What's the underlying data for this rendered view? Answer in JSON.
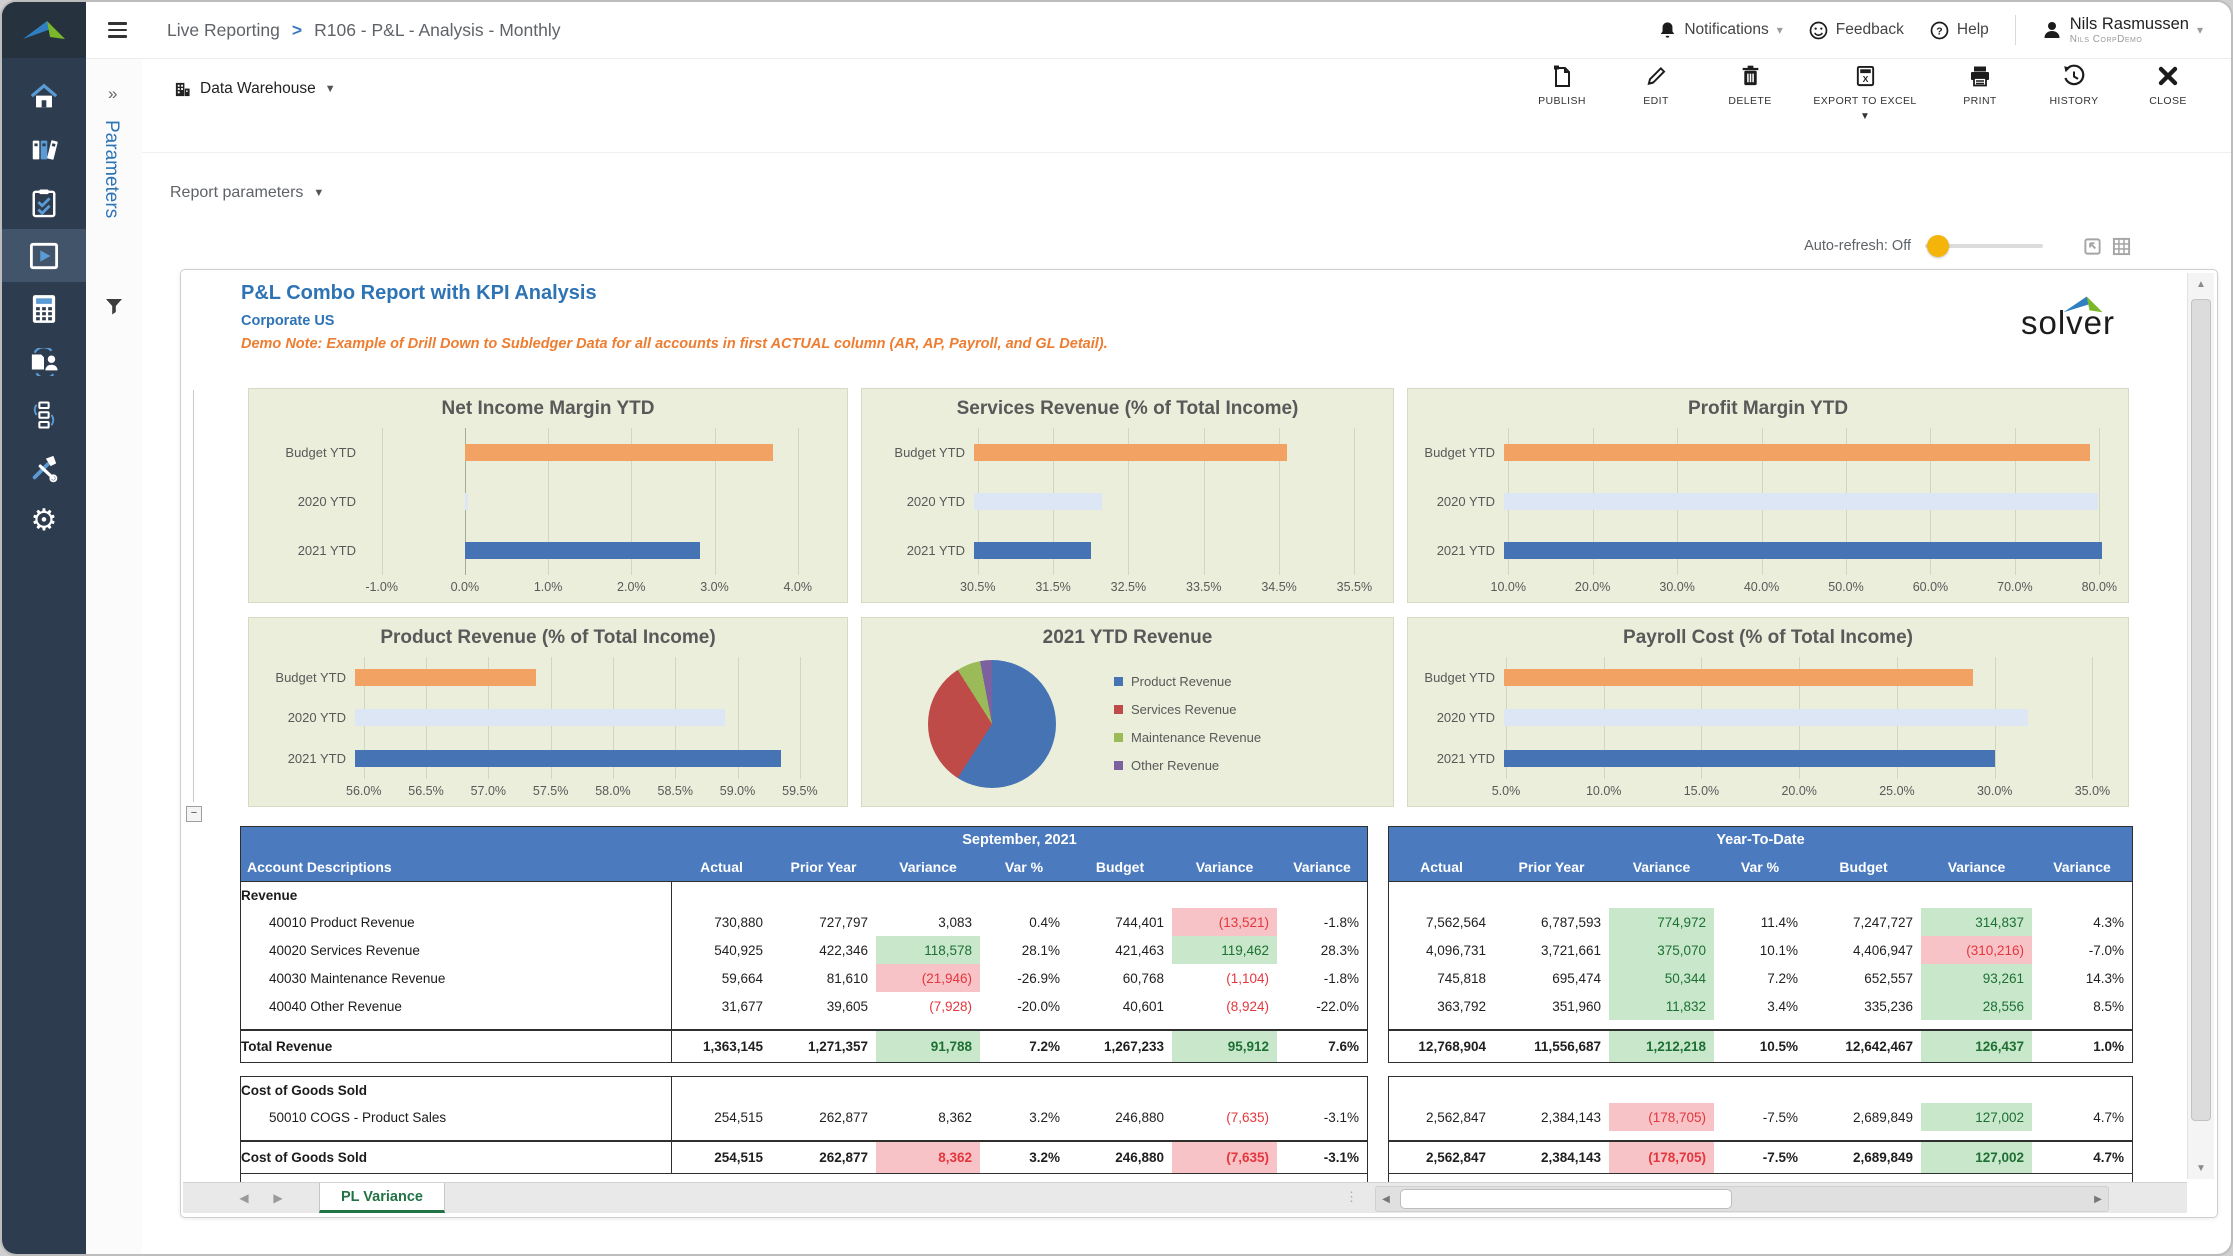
{
  "colors": {
    "accent_blue": "#2e74b5",
    "note_orange": "#ed7d31",
    "header_blue": "#4b7bbe",
    "bar_series": [
      "#f2a263",
      "#dce6f4",
      "#4573b4"
    ],
    "pos_bg": "#c9e8cb",
    "pos_text": "#1d6f33",
    "neg_bg": "#f8c3c7",
    "neg_text": "#e2373d",
    "tab_green": "#217346",
    "toggle_yellow": "#f5b40a",
    "chart_bg": "#eaeedb"
  },
  "topbar": {
    "breadcrumb": [
      "Live Reporting",
      "R106 - P&L - Analysis - Monthly"
    ],
    "breadcrumb_sep": ">",
    "notifications_label": "Notifications",
    "feedback_label": "Feedback",
    "help_label": "Help",
    "user_name": "Nils Rasmussen",
    "user_org": "Nils CorpDemo"
  },
  "toolbar": {
    "context_label": "Data Warehouse",
    "actions": [
      "PUBLISH",
      "EDIT",
      "DELETE",
      "EXPORT TO EXCEL",
      "PRINT",
      "HISTORY",
      "CLOSE"
    ]
  },
  "params_panel": {
    "title": "Parameters"
  },
  "report_params_label": "Report parameters",
  "auto_refresh_label": "Auto-refresh: Off",
  "report": {
    "title": "P&L Combo Report with KPI Analysis",
    "subtitle": "Corporate US",
    "note": "Demo Note: Example of Drill Down to Subledger Data for all accounts in first ACTUAL column (AR, AP, Payroll, and GL Detail).",
    "logo_text": "solver"
  },
  "chart_data": [
    {
      "type": "bar",
      "title": "Net Income Margin YTD",
      "categories": [
        "Budget YTD",
        "2020 YTD",
        "2021 YTD"
      ],
      "values": [
        3.7,
        0.04,
        2.83
      ],
      "unit": "%",
      "ticks": [
        -1.0,
        0.0,
        1.0,
        2.0,
        3.0,
        4.0
      ],
      "tick_labels": [
        "-1.0%",
        "0.0%",
        "1.0%",
        "2.0%",
        "3.0%",
        "4.0%"
      ],
      "axis": {
        "min": -1.2,
        "max": 4.4,
        "base": 0
      }
    },
    {
      "type": "bar",
      "title": "Services Revenue (% of Total Income)",
      "categories": [
        "Budget YTD",
        "2020 YTD",
        "2021 YTD"
      ],
      "values": [
        34.6,
        32.15,
        32.0
      ],
      "unit": "%",
      "ticks": [
        30.5,
        31.5,
        32.5,
        33.5,
        34.5,
        35.5
      ],
      "tick_labels": [
        "30.5%",
        "31.5%",
        "32.5%",
        "33.5%",
        "34.5%",
        "35.5%"
      ],
      "axis": {
        "min": 30.45,
        "max": 35.8,
        "base": 30.45
      }
    },
    {
      "type": "bar",
      "title": "Profit Margin YTD",
      "categories": [
        "Budget YTD",
        "2020 YTD",
        "2021 YTD"
      ],
      "values": [
        78.9,
        79.9,
        80.3
      ],
      "unit": "%",
      "ticks": [
        10,
        20,
        30,
        40,
        50,
        60,
        70,
        80
      ],
      "tick_labels": [
        "10.0%",
        "20.0%",
        "30.0%",
        "40.0%",
        "50.0%",
        "60.0%",
        "70.0%",
        "80.0%"
      ],
      "axis": {
        "min": 9.5,
        "max": 81.5,
        "base": 9.5
      }
    },
    {
      "type": "bar",
      "title": "Product Revenue (% of Total Income)",
      "categories": [
        "Budget YTD",
        "2020 YTD",
        "2021 YTD"
      ],
      "values": [
        57.38,
        58.9,
        59.35
      ],
      "unit": "%",
      "ticks": [
        56.0,
        56.5,
        57.0,
        57.5,
        58.0,
        58.5,
        59.0,
        59.5
      ],
      "tick_labels": [
        "56.0%",
        "56.5%",
        "57.0%",
        "57.5%",
        "58.0%",
        "58.5%",
        "59.0%",
        "59.5%"
      ],
      "axis": {
        "min": 55.93,
        "max": 59.75,
        "base": 55.93
      }
    },
    {
      "type": "pie",
      "title": "2021 YTD Revenue",
      "slices": [
        {
          "label": "Product Revenue",
          "value": 59,
          "color": "#4573b4"
        },
        {
          "label": "Services Revenue",
          "value": 32,
          "color": "#be4b48"
        },
        {
          "label": "Maintenance Revenue",
          "value": 6,
          "color": "#9bbb59"
        },
        {
          "label": "Other Revenue",
          "value": 3,
          "color": "#7c61a1"
        }
      ]
    },
    {
      "type": "bar",
      "title": "Payroll Cost (% of Total Income)",
      "categories": [
        "Budget YTD",
        "2020 YTD",
        "2021 YTD"
      ],
      "values": [
        28.9,
        31.7,
        30.0
      ],
      "unit": "%",
      "ticks": [
        5,
        10,
        15,
        20,
        25,
        30,
        35
      ],
      "tick_labels": [
        "5.0%",
        "10.0%",
        "15.0%",
        "20.0%",
        "25.0%",
        "30.0%",
        "35.0%"
      ],
      "axis": {
        "min": 4.9,
        "max": 36.0,
        "base": 4.9
      }
    }
  ],
  "table": {
    "account_header": "Account Descriptions",
    "groups": [
      "September, 2021",
      "Year-To-Date"
    ],
    "columns": [
      "Actual",
      "Prior Year",
      "Variance",
      "Var %",
      "Budget",
      "Variance",
      "Variance"
    ],
    "blocks": [
      {
        "section": "Revenue",
        "rows": [
          {
            "label": "40010 Product Revenue",
            "sep": [
              [
                "730,880",
                ""
              ],
              [
                "727,797",
                ""
              ],
              [
                "3,083",
                ""
              ],
              [
                "0.4%",
                ""
              ],
              [
                "744,401",
                ""
              ],
              [
                "(13,521)",
                "nb"
              ],
              [
                "-1.8%",
                ""
              ]
            ],
            "ytd": [
              [
                "7,562,564",
                ""
              ],
              [
                "6,787,593",
                ""
              ],
              [
                "774,972",
                "pb"
              ],
              [
                "11.4%",
                ""
              ],
              [
                "7,247,727",
                ""
              ],
              [
                "314,837",
                "pb"
              ],
              [
                "4.3%",
                ""
              ]
            ]
          },
          {
            "label": "40020 Services Revenue",
            "sep": [
              [
                "540,925",
                ""
              ],
              [
                "422,346",
                ""
              ],
              [
                "118,578",
                "pb"
              ],
              [
                "28.1%",
                ""
              ],
              [
                "421,463",
                ""
              ],
              [
                "119,462",
                "pb"
              ],
              [
                "28.3%",
                ""
              ]
            ],
            "ytd": [
              [
                "4,096,731",
                ""
              ],
              [
                "3,721,661",
                ""
              ],
              [
                "375,070",
                "pb"
              ],
              [
                "10.1%",
                ""
              ],
              [
                "4,406,947",
                ""
              ],
              [
                "(310,216)",
                "nb"
              ],
              [
                "-7.0%",
                ""
              ]
            ]
          },
          {
            "label": "40030 Maintenance Revenue",
            "sep": [
              [
                "59,664",
                ""
              ],
              [
                "81,610",
                ""
              ],
              [
                "(21,946)",
                "nb"
              ],
              [
                "-26.9%",
                ""
              ],
              [
                "60,768",
                ""
              ],
              [
                "(1,104)",
                "nt"
              ],
              [
                "-1.8%",
                ""
              ]
            ],
            "ytd": [
              [
                "745,818",
                ""
              ],
              [
                "695,474",
                ""
              ],
              [
                "50,344",
                "pb"
              ],
              [
                "7.2%",
                ""
              ],
              [
                "652,557",
                ""
              ],
              [
                "93,261",
                "pb"
              ],
              [
                "14.3%",
                ""
              ]
            ]
          },
          {
            "label": "40040 Other Revenue",
            "sep": [
              [
                "31,677",
                ""
              ],
              [
                "39,605",
                ""
              ],
              [
                "(7,928)",
                "nt"
              ],
              [
                "-20.0%",
                ""
              ],
              [
                "40,601",
                ""
              ],
              [
                "(8,924)",
                "nt"
              ],
              [
                "-22.0%",
                ""
              ]
            ],
            "ytd": [
              [
                "363,792",
                ""
              ],
              [
                "351,960",
                ""
              ],
              [
                "11,832",
                "pb"
              ],
              [
                "3.4%",
                ""
              ],
              [
                "335,236",
                ""
              ],
              [
                "28,556",
                "pb"
              ],
              [
                "8.5%",
                ""
              ]
            ]
          }
        ],
        "total": {
          "label": "Total Revenue",
          "sep": [
            [
              "1,363,145",
              ""
            ],
            [
              "1,271,357",
              ""
            ],
            [
              "91,788",
              "pb"
            ],
            [
              "7.2%",
              ""
            ],
            [
              "1,267,233",
              ""
            ],
            [
              "95,912",
              "pb"
            ],
            [
              "7.6%",
              ""
            ]
          ],
          "ytd": [
            [
              "12,768,904",
              ""
            ],
            [
              "11,556,687",
              ""
            ],
            [
              "1,212,218",
              "pb"
            ],
            [
              "10.5%",
              ""
            ],
            [
              "12,642,467",
              ""
            ],
            [
              "126,437",
              "pb"
            ],
            [
              "1.0%",
              ""
            ]
          ]
        }
      },
      {
        "section": "Cost of Goods Sold",
        "rows": [
          {
            "label": "50010 COGS - Product Sales",
            "sep": [
              [
                "254,515",
                ""
              ],
              [
                "262,877",
                ""
              ],
              [
                "8,362",
                ""
              ],
              [
                "3.2%",
                ""
              ],
              [
                "246,880",
                ""
              ],
              [
                "(7,635)",
                "nt"
              ],
              [
                "-3.1%",
                ""
              ]
            ],
            "ytd": [
              [
                "2,562,847",
                ""
              ],
              [
                "2,384,143",
                ""
              ],
              [
                "(178,705)",
                "nb"
              ],
              [
                "-7.5%",
                ""
              ],
              [
                "2,689,849",
                ""
              ],
              [
                "127,002",
                "pb"
              ],
              [
                "4.7%",
                ""
              ]
            ]
          }
        ],
        "total": {
          "label": "Cost of Goods Sold",
          "sep": [
            [
              "254,515",
              ""
            ],
            [
              "262,877",
              ""
            ],
            [
              "8,362",
              "nb"
            ],
            [
              "3.2%",
              ""
            ],
            [
              "246,880",
              ""
            ],
            [
              "(7,635)",
              "nb"
            ],
            [
              "-3.1%",
              ""
            ]
          ],
          "ytd": [
            [
              "2,562,847",
              ""
            ],
            [
              "2,384,143",
              ""
            ],
            [
              "(178,705)",
              "nb"
            ],
            [
              "-7.5%",
              ""
            ],
            [
              "2,689,849",
              ""
            ],
            [
              "127,002",
              "pb"
            ],
            [
              "4.7%",
              ""
            ]
          ]
        }
      }
    ]
  },
  "sheet": {
    "tab": "PL Variance"
  }
}
